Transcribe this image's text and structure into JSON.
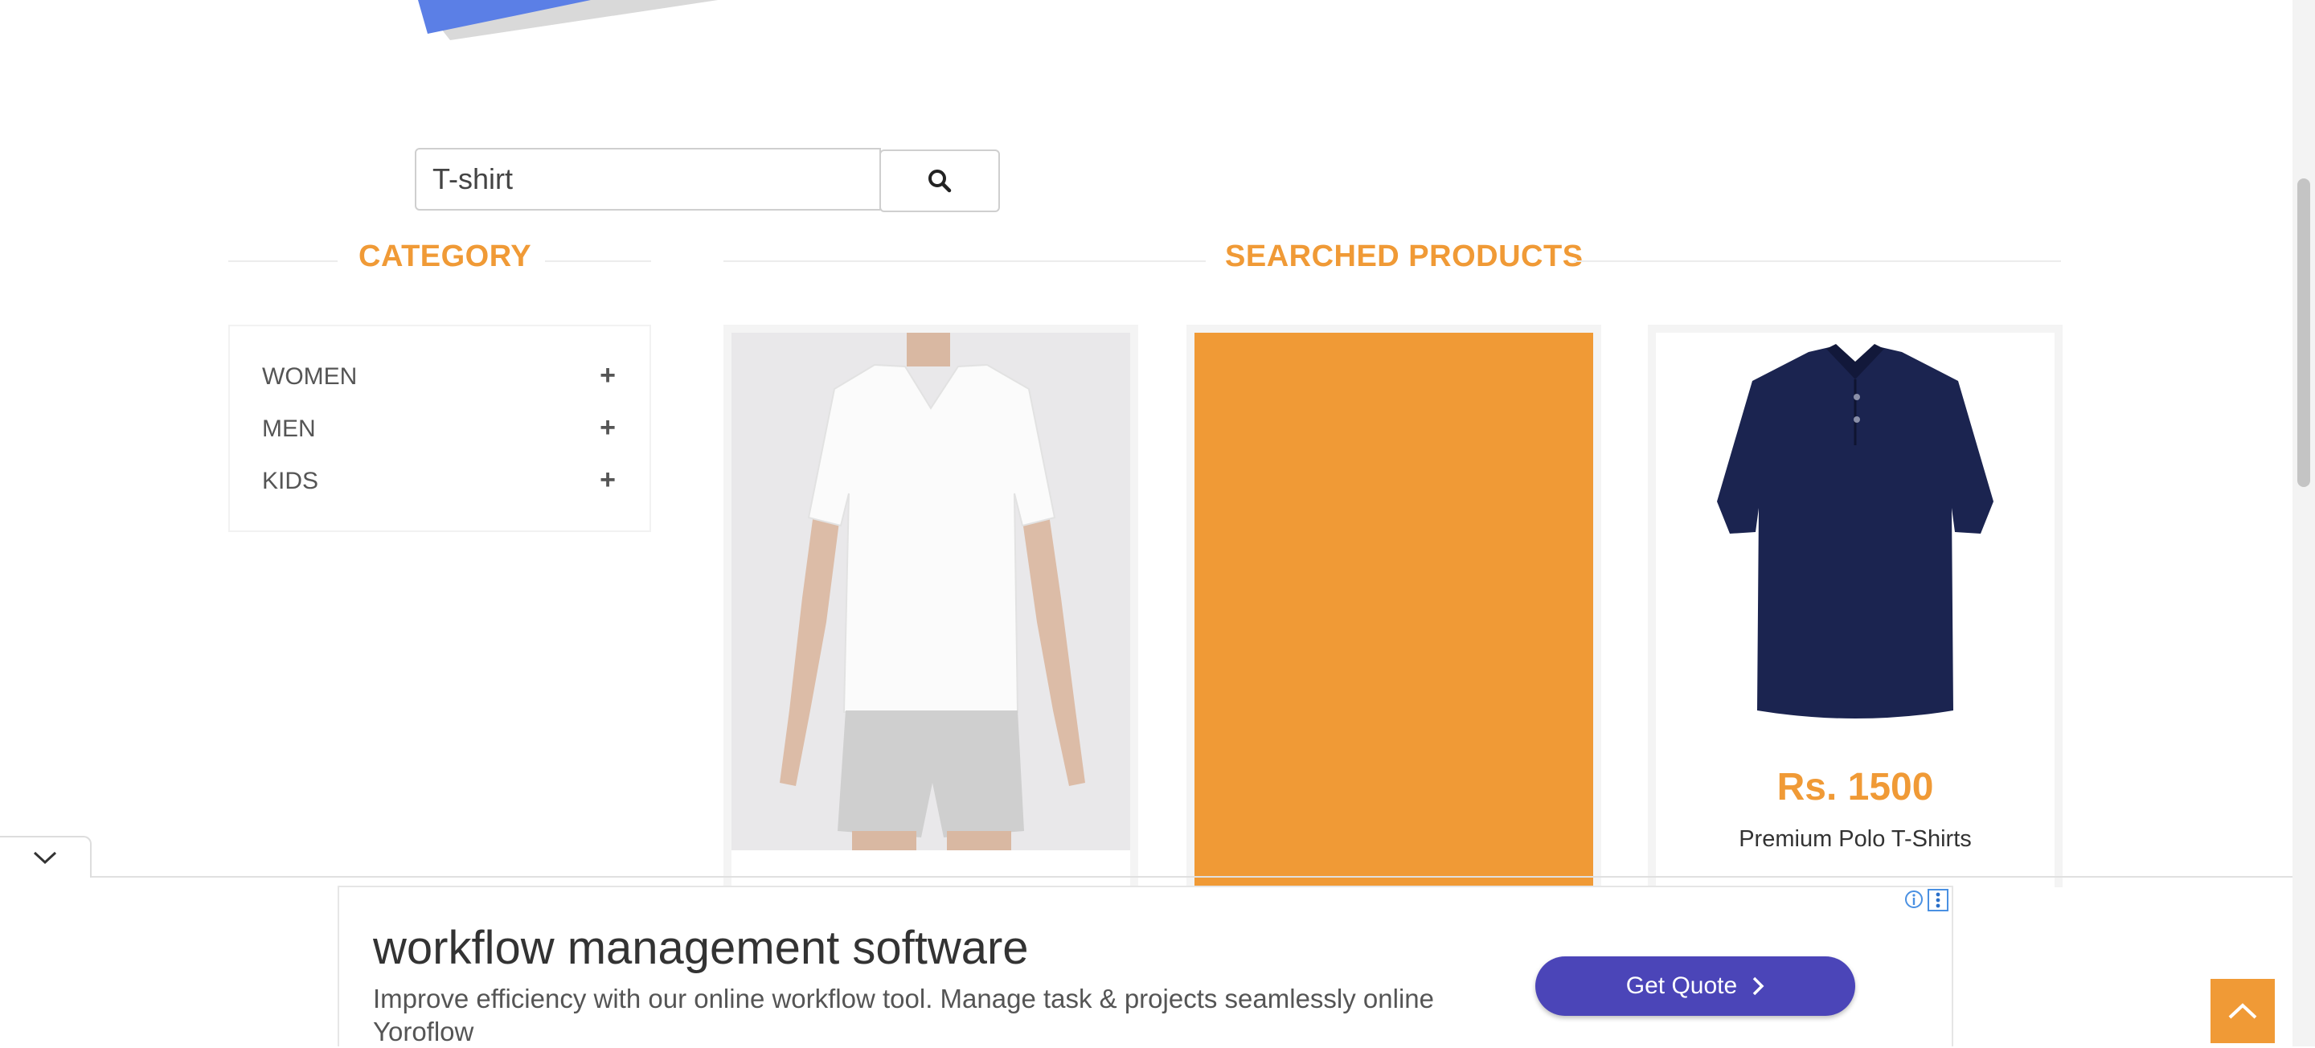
{
  "search": {
    "value": "T-shirt",
    "button_icon": "search-icon"
  },
  "sidebar": {
    "heading": "CATEGORY",
    "items": [
      {
        "label": "WOMEN",
        "icon": "plus-icon"
      },
      {
        "label": "MEN",
        "icon": "plus-icon"
      },
      {
        "label": "KIDS",
        "icon": "plus-icon"
      }
    ]
  },
  "products": {
    "heading": "SEARCHED PRODUCTS",
    "items": [
      {
        "image": "white-tshirt-model-image"
      },
      {
        "image": "orange-placeholder-image"
      },
      {
        "image": "navy-polo-image",
        "price": "Rs. 1500",
        "name": "Premium Polo T-Shirts"
      }
    ]
  },
  "ad": {
    "title": "workflow management software",
    "description": "Improve efficiency with our online workflow tool. Manage task & projects seamlessly online",
    "advertiser": "Yoroflow",
    "cta": "Get Quote"
  },
  "colors": {
    "accent": "#f09a36",
    "cta": "#4b45b8",
    "logo_blue": "#5b7fe6"
  }
}
